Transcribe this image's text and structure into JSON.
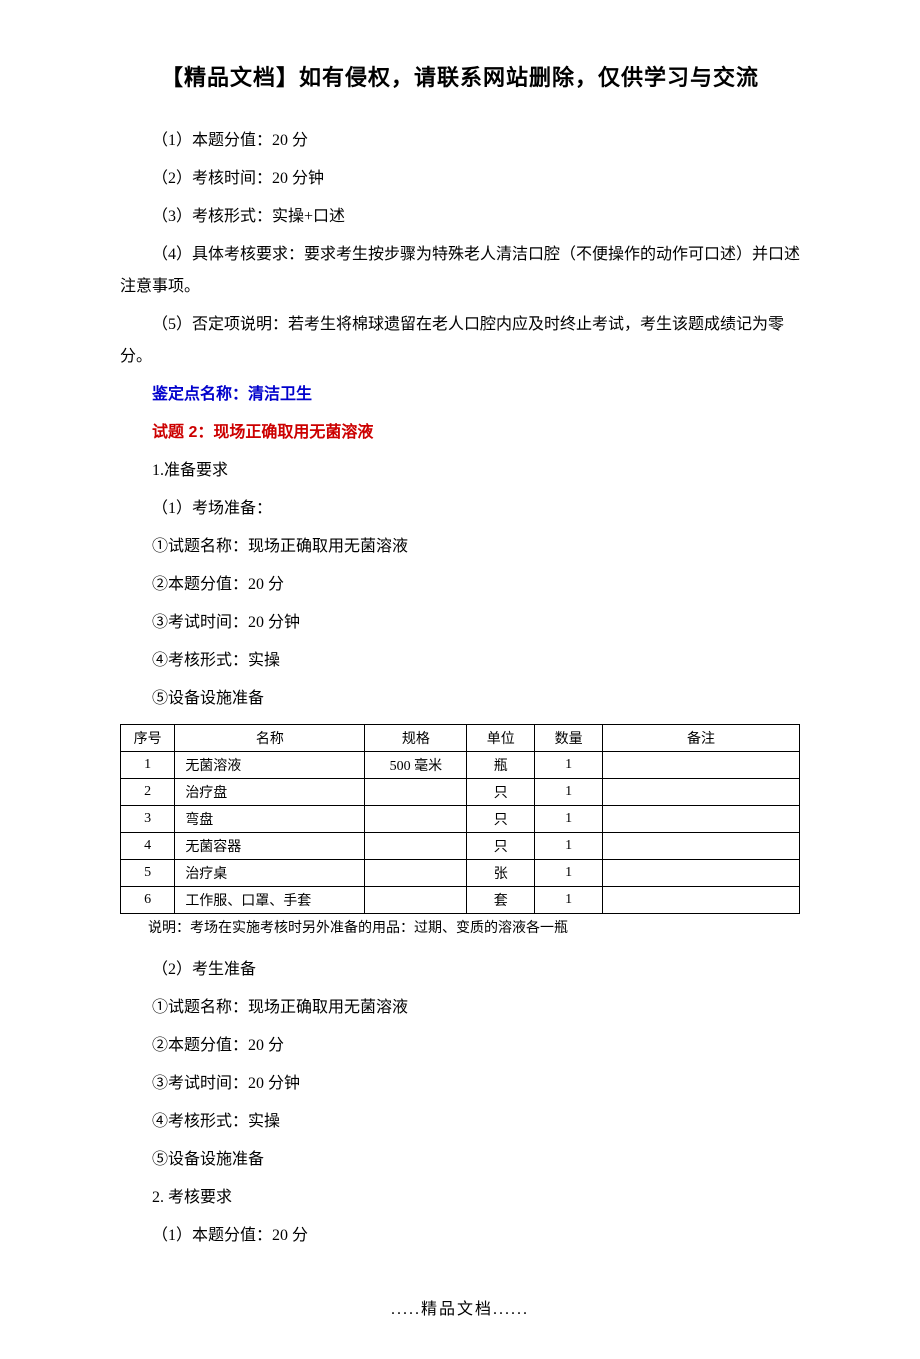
{
  "header": {
    "title": "【精品文档】如有侵权，请联系网站删除，仅供学习与交流"
  },
  "section1": {
    "p1": "（1）本题分值：20 分",
    "p2": "（2）考核时间：20 分钟",
    "p3": "（3）考核形式：实操+口述",
    "p4": "（4）具体考核要求：要求考生按步骤为特殊老人清洁口腔（不便操作的动作可口述）并口述注意事项。",
    "p5": "（5）否定项说明：若考生将棉球遗留在老人口腔内应及时终止考试，考生该题成绩记为零分。"
  },
  "assessPoint": {
    "label": "鉴定点名称：清洁卫生"
  },
  "question2": {
    "title": "试题 2：现场正确取用无菌溶液",
    "prep_heading": "1.准备要求",
    "venue_heading": "（1）考场准备：",
    "v1": "①试题名称：现场正确取用无菌溶液",
    "v2": "②本题分值：20 分",
    "v3": "③考试时间：20 分钟",
    "v4": "④考核形式：实操",
    "v5": "⑤设备设施准备"
  },
  "table": {
    "headers": {
      "seq": "序号",
      "name": "名称",
      "spec": "规格",
      "unit": "单位",
      "qty": "数量",
      "remark": "备注"
    },
    "rows": [
      {
        "seq": "1",
        "name": "无菌溶液",
        "spec": "500 毫米",
        "unit": "瓶",
        "qty": "1",
        "remark": ""
      },
      {
        "seq": "2",
        "name": "治疗盘",
        "spec": "",
        "unit": "只",
        "qty": "1",
        "remark": ""
      },
      {
        "seq": "3",
        "name": "弯盘",
        "spec": "",
        "unit": "只",
        "qty": "1",
        "remark": ""
      },
      {
        "seq": "4",
        "name": "无菌容器",
        "spec": "",
        "unit": "只",
        "qty": "1",
        "remark": ""
      },
      {
        "seq": "5",
        "name": "治疗桌",
        "spec": "",
        "unit": "张",
        "qty": "1",
        "remark": ""
      },
      {
        "seq": "6",
        "name": "工作服、口罩、手套",
        "spec": "",
        "unit": "套",
        "qty": "1",
        "remark": ""
      }
    ],
    "note": "说明：考场在实施考核时另外准备的用品：过期、变质的溶液各一瓶"
  },
  "candidate": {
    "heading": "（2）考生准备",
    "c1": "①试题名称：现场正确取用无菌溶液",
    "c2": "②本题分值：20 分",
    "c3": "③考试时间：20 分钟",
    "c4": "④考核形式：实操",
    "c5": "⑤设备设施准备"
  },
  "requirements": {
    "heading": "2. 考核要求",
    "r1": "（1）本题分值：20 分"
  },
  "footer": {
    "text": ".....精品文档......"
  }
}
